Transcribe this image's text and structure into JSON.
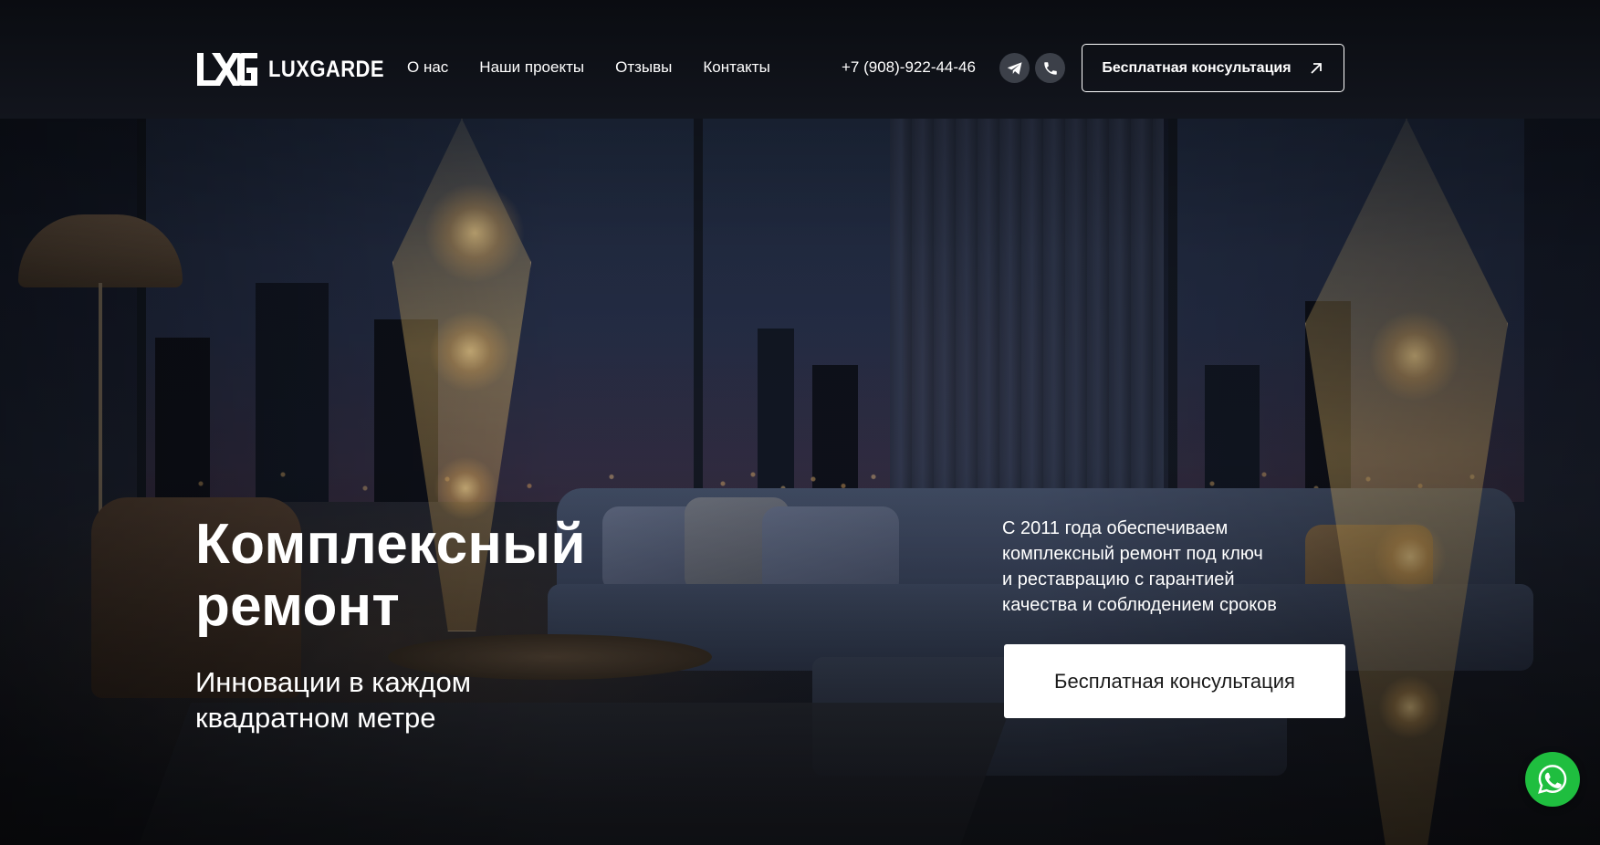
{
  "header": {
    "logo_text": "LUXGARDE",
    "nav": [
      {
        "label": "О нас"
      },
      {
        "label": "Наши проекты"
      },
      {
        "label": "Отзывы"
      },
      {
        "label": "Контакты"
      }
    ],
    "phone": "+7 (908)-922-44-46",
    "icons": [
      "telegram-icon",
      "phone-icon"
    ],
    "cta_label": "Бесплатная консультация"
  },
  "hero": {
    "title_line1": "Комплексный",
    "title_line2": "ремонт",
    "subtitle_line1": "Инновации в каждом",
    "subtitle_line2": "квадратном метре",
    "description_lines": [
      "С 2011 года обеспечиваем",
      "комплексный ремонт под ключ",
      "и реставрацию с гарантией",
      "качества и соблюдением сроков"
    ],
    "cta_label": "Бесплатная консультация"
  },
  "floating": {
    "icon": "whatsapp-icon"
  },
  "colors": {
    "header_bg": "#0a0c11",
    "icon_circle": "#3c4049",
    "whatsapp_green": "#1fbe3f",
    "button_bg": "#ffffff",
    "button_text": "#1a1a1a"
  }
}
